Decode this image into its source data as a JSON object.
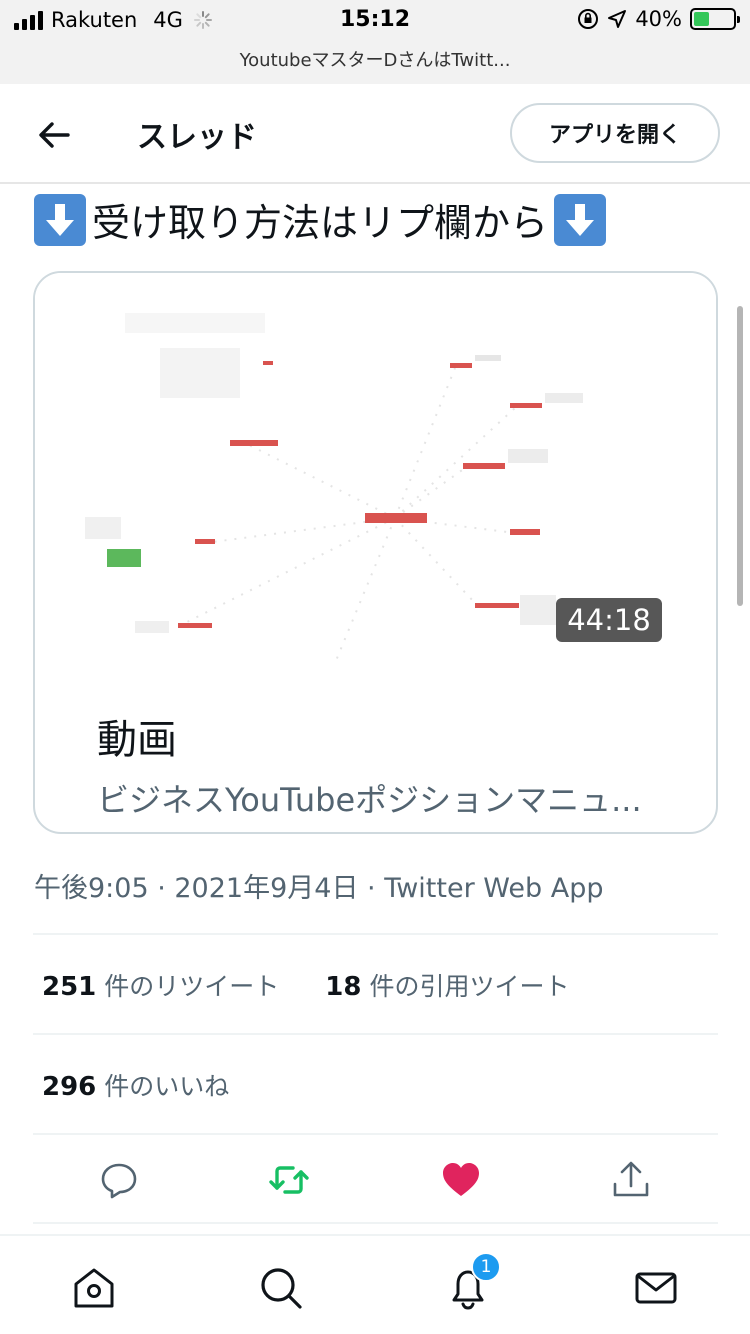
{
  "status_bar": {
    "carrier": "Rakuten",
    "network": "4G",
    "time": "15:12",
    "battery": "40%",
    "battery_level": 0.4,
    "icons": [
      "signal-icon",
      "loading-spinner-icon",
      "orientation-lock-icon",
      "location-arrow-icon",
      "battery-charging-icon"
    ]
  },
  "url_bar": {
    "title": "YoutubeマスターDさんはTwitt..."
  },
  "header": {
    "back_icon": "arrow-left-icon",
    "title": "スレッド",
    "open_app_label": "アプリを開く"
  },
  "tweet": {
    "text": "受け取り方法はリプ欄から",
    "emoji": "down-arrow-emoji"
  },
  "card": {
    "duration": "44:18",
    "title": "動画",
    "description": "ビジネスYouTubeポジションマニュ..."
  },
  "meta": {
    "timestamp": "午後9:05 · 2021年9月4日 · Twitter Web App"
  },
  "stats": {
    "retweets_count": "251",
    "retweets_label": "件のリツイート",
    "quotes_count": "18",
    "quotes_label": "件の引用ツイート",
    "likes_count": "296",
    "likes_label": "件のいいね"
  },
  "actions": {
    "reply_icon": "reply-icon",
    "retweet_icon": "retweet-icon",
    "like_icon": "heart-icon",
    "share_icon": "share-icon",
    "retweet_color": "#17bf63",
    "like_color": "#e0245e"
  },
  "bottom_nav": {
    "items": [
      "home-icon",
      "search-icon",
      "notifications-icon",
      "messages-icon"
    ],
    "notification_badge": "1"
  }
}
